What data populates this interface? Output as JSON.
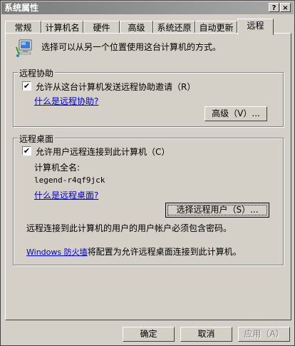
{
  "window": {
    "title": "系统属性",
    "help_glyph": "?",
    "close_glyph": "×"
  },
  "tabs": [
    {
      "label": "常规"
    },
    {
      "label": "计算机名"
    },
    {
      "label": "硬件"
    },
    {
      "label": "高级"
    },
    {
      "label": "系统还原"
    },
    {
      "label": "自动更新"
    },
    {
      "label": "远程"
    }
  ],
  "intro_text": "选择可以从另一个位置使用这台计算机的方式。",
  "remote_assistance": {
    "group_title": "远程协助",
    "checkbox_label": "允许从这台计算机发送远程协助邀请（R）",
    "checked": true,
    "link": "什么是远程协助?",
    "advanced_button": "高级（V）..."
  },
  "remote_desktop": {
    "group_title": "远程桌面",
    "checkbox_label": "允许用户远程连接到此计算机（C）",
    "checked": true,
    "fullname_label": "计算机全名:",
    "computer_name": "legend-r4qf9jck",
    "link": "什么是远程桌面?",
    "select_users_button": "选择远程用户（S）...",
    "password_note": "远程连接到此计算机的用户的用户帐户必须包含密码。",
    "firewall_link": "Windows 防火墙",
    "firewall_text": "将配置为允许远程桌面连接到此计算机。"
  },
  "footer": {
    "ok": "确定",
    "cancel": "取消",
    "apply": "应用（A）"
  },
  "icons": {
    "computer": "computer-icon"
  }
}
